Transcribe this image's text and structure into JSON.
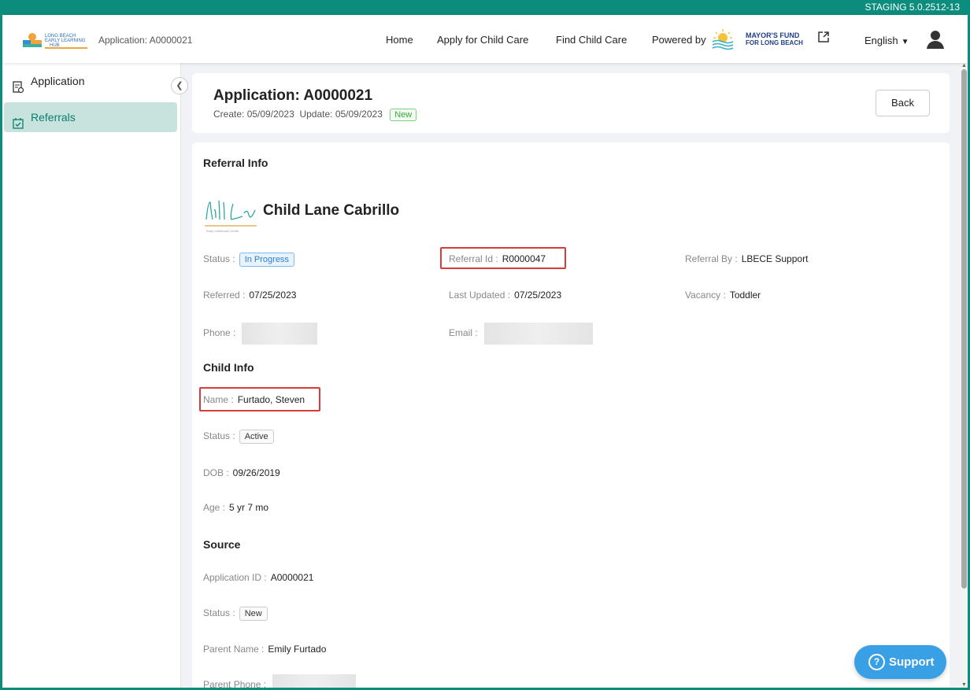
{
  "staging_label": "STAGING 5.0.2512-13",
  "nav": {
    "logo_text_1": "LONG BEACH",
    "logo_text_2": "EARLY LEARNING",
    "logo_text_3": "HUB",
    "app_label": "Application: A0000021",
    "links": [
      "Home",
      "Apply for Child Care",
      "Find Child Care"
    ],
    "powered_by": "Powered by",
    "mayors_fund_1": "MAYOR'S FUND",
    "mayors_fund_2": "FOR LONG BEACH",
    "language": "English"
  },
  "sidebar": {
    "items": [
      {
        "label": "Application",
        "icon": "document-icon"
      },
      {
        "label": "Referrals",
        "icon": "checklist-icon"
      }
    ]
  },
  "header": {
    "title": "Application: A0000021",
    "create_label": "Create:",
    "create_date": "05/09/2023",
    "update_label": "Update:",
    "update_date": "05/09/2023",
    "status_badge": "New",
    "back_label": "Back"
  },
  "referral": {
    "section_title": "Referral Info",
    "provider_name": "Child Lane Cabrillo",
    "status_label": "Status :",
    "status_value": "In Progress",
    "referral_id_label": "Referral Id :",
    "referral_id_value": "R0000047",
    "referral_by_label": "Referral By :",
    "referral_by_value": "LBECE Support",
    "referred_label": "Referred :",
    "referred_value": "07/25/2023",
    "last_updated_label": "Last Updated :",
    "last_updated_value": "07/25/2023",
    "vacancy_label": "Vacancy :",
    "vacancy_value": "Toddler",
    "phone_label": "Phone :",
    "email_label": "Email :"
  },
  "child": {
    "section_title": "Child Info",
    "name_label": "Name :",
    "name_value": "Furtado, Steven",
    "status_label": "Status :",
    "status_value": "Active",
    "dob_label": "DOB :",
    "dob_value": "09/26/2019",
    "age_label": "Age :",
    "age_value": "5 yr 7 mo"
  },
  "source": {
    "section_title": "Source",
    "app_id_label": "Application ID :",
    "app_id_value": "A0000021",
    "status_label": "Status :",
    "status_value": "New",
    "parent_name_label": "Parent Name :",
    "parent_name_value": "Emily Furtado",
    "parent_phone_label": "Parent Phone :"
  },
  "support_label": "Support",
  "colors": {
    "brand_teal": "#0b8c7d",
    "support_blue": "#3aa0e6",
    "highlight_red": "#d93a3a"
  }
}
